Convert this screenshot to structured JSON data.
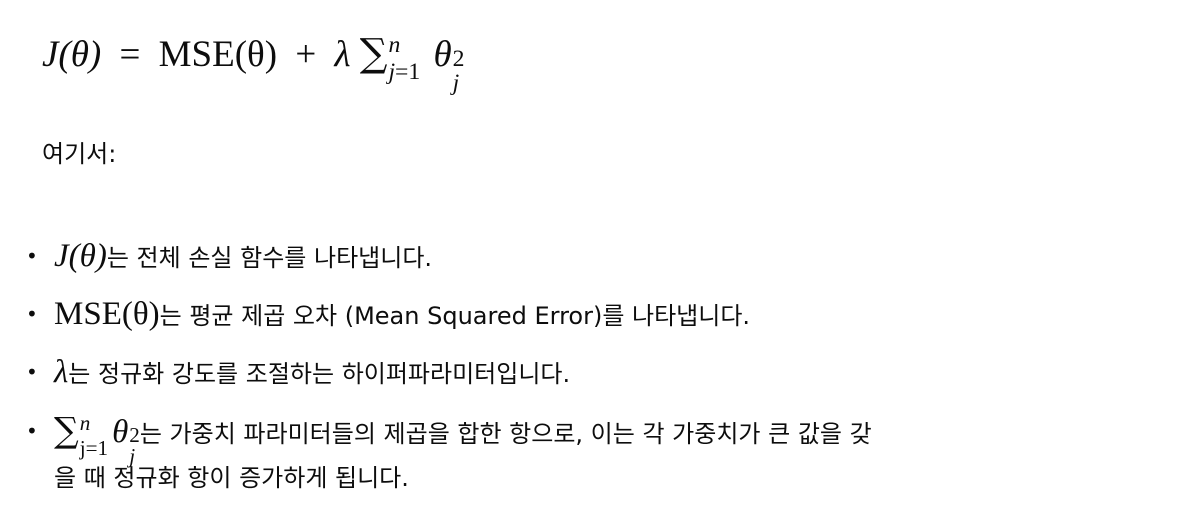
{
  "formula": {
    "lhs": "J(θ)",
    "equals": "=",
    "mse": "MSE(θ)",
    "plus": "+",
    "lambda": "λ",
    "sum_symbol": "∑",
    "sum_upper": "n",
    "sum_lower": "j=1",
    "theta": "θ",
    "power": "2",
    "index": "j"
  },
  "intro": "여기서:",
  "items": [
    {
      "math": "J(θ)",
      "text": "는 전체 손실 함수를 나타냅니다."
    },
    {
      "math": "MSE(θ)",
      "text": "는 평균 제곱 오차 (Mean Squared Error)를 나타냅니다."
    },
    {
      "math": "λ",
      "text": "는 정규화 강도를 조절하는 하이퍼파라미터입니다."
    },
    {
      "math_sum_upper": "n",
      "math_sum_lower": "j=1",
      "math_theta": "θ",
      "math_power": "2",
      "math_index": "j",
      "text": "는 가중치 파라미터들의 제곱을 합한 항으로, 이는 각 가중치가 큰 값을 갖",
      "text_cont": "을 때 정규화 항이 증가하게 됩니다."
    }
  ]
}
